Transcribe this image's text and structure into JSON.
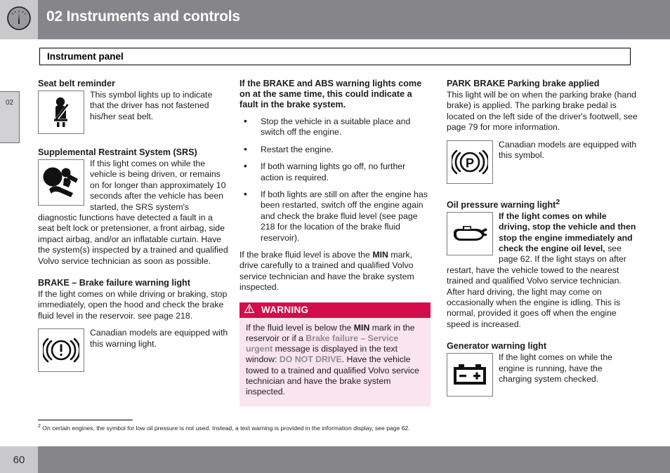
{
  "header": {
    "chapter_number": "02",
    "title": "02 Instruments and controls",
    "icon": "gauge-icon",
    "bg_color": "#86868a",
    "icon_bg_color": "#c9c9cb"
  },
  "chapter_tab": {
    "label": "02"
  },
  "section": {
    "title": "Instrument panel"
  },
  "column1": {
    "seat_belt": {
      "heading": "Seat belt reminder",
      "icon": "seat-belt-reminder-icon",
      "text": "This symbol lights up to indicate that the driver has not fastened his/her seat belt."
    },
    "srs": {
      "heading": "Supplemental Restraint System (SRS)",
      "icon": "srs-airbag-icon",
      "text": "If this light comes on while the vehicle is being driven, or remains on for longer than approximately 10 seconds after the vehicle has been started, the SRS system's diagnostic functions have detected a fault in a seat belt lock or pretensioner, a front airbag, side impact airbag, and/or an inflatable curtain. Have the system(s) inspected by a trained and qualified Volvo service technician as soon as possible."
    },
    "brake": {
      "heading": "BRAKE – Brake failure warning light",
      "text": "If the light comes on while driving or braking, stop immediately, open the hood and check the brake fluid level in the reservoir. see page 218.",
      "icon": "brake-failure-warning-icon",
      "icon_text": "Canadian models are equipped with this warning light."
    }
  },
  "column2": {
    "brake_abs": {
      "heading": "If the BRAKE and ABS warning lights come on at the same time, this could indicate a fault in the brake system.",
      "bullets": [
        "Stop the vehicle in a suitable place and switch off the engine.",
        "Restart the engine.",
        "If both warning lights go off, no further action is required.",
        "If both lights are still on after the engine has been restarted, switch off the engine again and check the brake fluid level (see page 218 for the location of the brake fluid reservoir)."
      ],
      "after_text_1": "If the brake fluid level is above the ",
      "after_text_bold": "MIN",
      "after_text_2": " mark, drive carefully to a trained and qualified Volvo service technician and have the brake system inspected."
    },
    "warning": {
      "icon": "warning-triangle-icon",
      "label": "WARNING",
      "header_color": "#d40b4c",
      "body_color": "#fae4ed",
      "text_1": "If the fluid level is below the ",
      "text_bold_1": "MIN",
      "text_2": " mark in the reservoir or if a ",
      "text_gray_1": "Brake failure – Service urgent",
      "text_3": " message is displayed in the text window: ",
      "text_gray_2": "DO NOT DRIVE",
      "text_4": ". Have the vehicle towed to a trained and qualified Volvo service technician and have the brake system inspected."
    }
  },
  "column3": {
    "park_brake": {
      "heading_bold": "PARK BRAKE",
      "heading_rest": " Parking brake applied",
      "text": "This light will be on when the parking brake (hand brake) is applied. The parking brake pedal is located on the left side of the driver's footwell, see page 79 for more information.",
      "icon": "park-brake-icon",
      "icon_text": "Canadian models are equipped with this symbol."
    },
    "oil_pressure": {
      "heading": "Oil pressure warning light",
      "heading_sup": "2",
      "icon": "oil-pressure-icon",
      "text_bold": "If the light comes on while driving, stop the vehicle and then stop the engine immediately and check the engine oil level,",
      "text_rest": " see page 62. If the light stays on after restart, have the vehicle towed to the nearest trained and qualified Volvo service technician. After hard driving, the light may come on occasionally when the engine is idling. This is normal, provided it goes off when the engine speed is increased."
    },
    "generator": {
      "heading": "Generator warning light",
      "icon": "battery-generator-icon",
      "text": "If the light comes on while the engine is running, have the charging system checked."
    }
  },
  "footnote": {
    "marker": "2",
    "text": "On certain engines, the symbol for low oil pressure is not used. Instead, a text warning is provided in the information display, see page 62."
  },
  "footer": {
    "page_number": "60",
    "bg_color": "#86868a",
    "page_box_color": "#c9c9cb"
  }
}
